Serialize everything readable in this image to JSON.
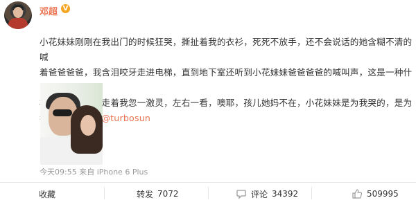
{
  "user": {
    "name": "邓超",
    "vip_badge": "V"
  },
  "post": {
    "text_main": "小花妹妹刚刚在我出门的时候狂哭，撕扯着我的衣衫，死死不放手，还不会说话的她含糊不清的喊\n着爸爸爸爸，我含泪咬牙走进电梯，直到地下室还听到小花妹妹爸爸爸爸的喊叫声，这是一种什么\n样的爱啊，走着走着我忽一激灵，左右一看，噢耶，孩儿她妈不在，小花妹妹是为我哭的，是为\n我，是我，我...",
    "mention": "@turbosun",
    "timestamp": "今天09:55 来自 iPhone 6 Plus"
  },
  "actions": {
    "favorite_label": "收藏",
    "repost_label": "转发",
    "repost_count": "7072",
    "comment_label": "评论",
    "comment_count": "34392",
    "like_count": "509995"
  },
  "colors": {
    "accent": "#eb7350",
    "vip": "#f6a623",
    "text": "#333333",
    "muted": "#999999"
  },
  "icons": {
    "repost": "repost-icon",
    "comment": "comment-icon",
    "like": "thumbs-up-icon"
  }
}
